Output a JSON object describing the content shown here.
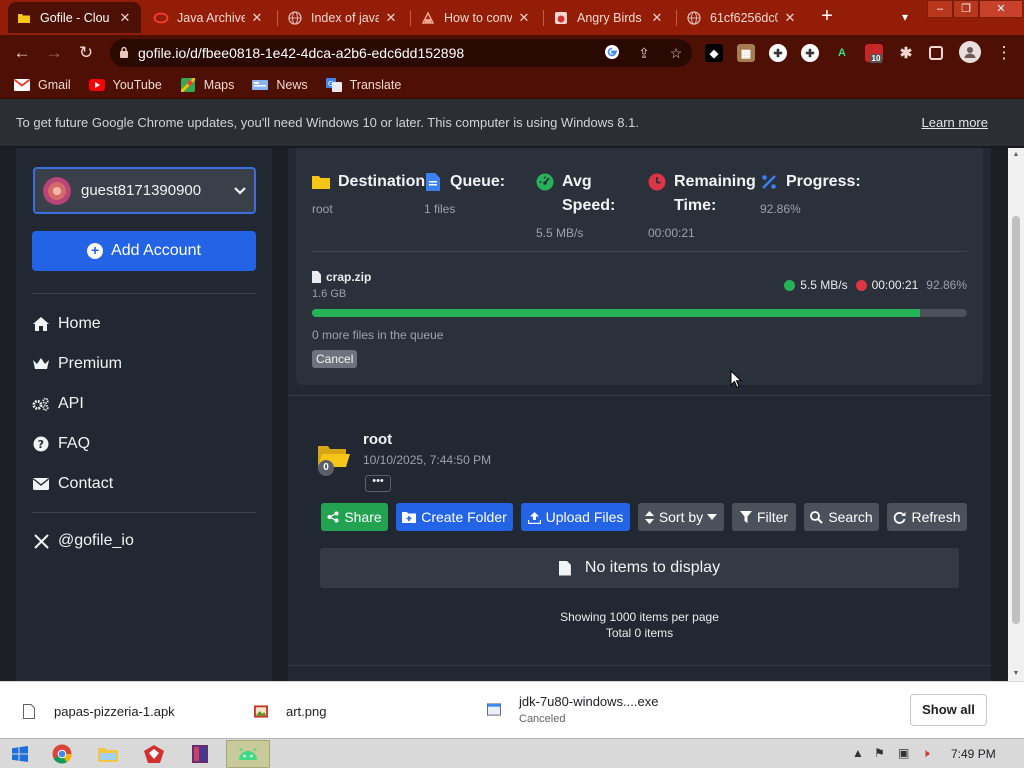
{
  "browser": {
    "tabs": [
      {
        "title": "Gofile - Clou",
        "active": true,
        "favicon": "gofile-icon"
      },
      {
        "title": "Java Archive",
        "active": false,
        "favicon": "opera-ring-icon"
      },
      {
        "title": "Index of java",
        "active": false,
        "favicon": "globe-icon"
      },
      {
        "title": "How to conv",
        "active": false,
        "favicon": "page-icon"
      },
      {
        "title": "Angry Birds",
        "active": false,
        "favicon": "game-icon"
      },
      {
        "title": "61cf6256dc0",
        "active": false,
        "favicon": "globe-icon"
      }
    ],
    "url": "gofile.io/d/fbee0818-1e42-4dca-a2b6-edc6dd152898",
    "extension_badge": "10",
    "bookmarks": [
      {
        "label": "Gmail",
        "icon": "gmail-icon",
        "color": "#ea4335"
      },
      {
        "label": "YouTube",
        "icon": "youtube-icon",
        "color": "#ff0000"
      },
      {
        "label": "Maps",
        "icon": "maps-icon",
        "color": "#34a853"
      },
      {
        "label": "News",
        "icon": "news-icon",
        "color": "#4285f4"
      },
      {
        "label": "Translate",
        "icon": "translate-icon",
        "color": "#4285f4"
      }
    ],
    "infobar": {
      "message": "To get future Google Chrome updates, you'll need Windows 10 or later. This computer is using Windows 8.1.",
      "link": "Learn more"
    },
    "theme_color": "#941d08"
  },
  "sidebar": {
    "account": "guest8171390900",
    "add_account": "Add Account",
    "nav": [
      {
        "label": "Home",
        "icon": "home-icon"
      },
      {
        "label": "Premium",
        "icon": "crown-icon"
      },
      {
        "label": "API",
        "icon": "cogs-icon"
      },
      {
        "label": "FAQ",
        "icon": "question-icon"
      },
      {
        "label": "Contact",
        "icon": "envelope-icon"
      }
    ],
    "social": {
      "label": "@gofile_io",
      "icon": "x-logo-icon"
    }
  },
  "upload": {
    "stats": [
      {
        "label": "Destination:",
        "value": "root",
        "icon": "folder-icon",
        "color": "#f5c518"
      },
      {
        "label": "Queue:",
        "value": "1 files",
        "icon": "file-icon",
        "color": "#3b82f6"
      },
      {
        "label": "Avg Speed:",
        "value": "5.5 MB/s",
        "icon": "gauge-icon",
        "color": "#25b35a"
      },
      {
        "label": "Remaining Time:",
        "value": "00:00:21",
        "icon": "clock-icon",
        "color": "#dc3545"
      },
      {
        "label": "Progress:",
        "value": "92.86%",
        "icon": "percent-icon",
        "color": "#3b82f6"
      }
    ],
    "file": {
      "name": "crap.zip",
      "size": "1.6 GB",
      "speed": "5.5 MB/s",
      "remaining": "00:00:21",
      "percent": "92.86%",
      "progress": 0.9286
    },
    "queue_note": "0 more files in the queue",
    "cancel": "Cancel"
  },
  "folder": {
    "title": "root",
    "date": "10/10/2025, 7:44:50 PM",
    "count": "0",
    "more": "•••"
  },
  "actions": {
    "share": "Share",
    "create_folder": "Create Folder",
    "upload_files": "Upload Files",
    "sort_by": "Sort by",
    "filter": "Filter",
    "search": "Search",
    "refresh": "Refresh"
  },
  "listing": {
    "empty": "No items to display",
    "per_page": "Showing 1000 items per page",
    "total": "Total 0 items"
  },
  "downloads": {
    "items": [
      {
        "name": "papas-pizzeria-1.apk",
        "status": "",
        "icon": "file-icon"
      },
      {
        "name": "art.png",
        "status": "",
        "icon": "image-icon"
      },
      {
        "name": "jdk-7u80-windows....exe",
        "status": "Canceled",
        "icon": "exe-icon"
      }
    ],
    "show_all": "Show all"
  },
  "taskbar": {
    "time": "7:49 PM"
  }
}
